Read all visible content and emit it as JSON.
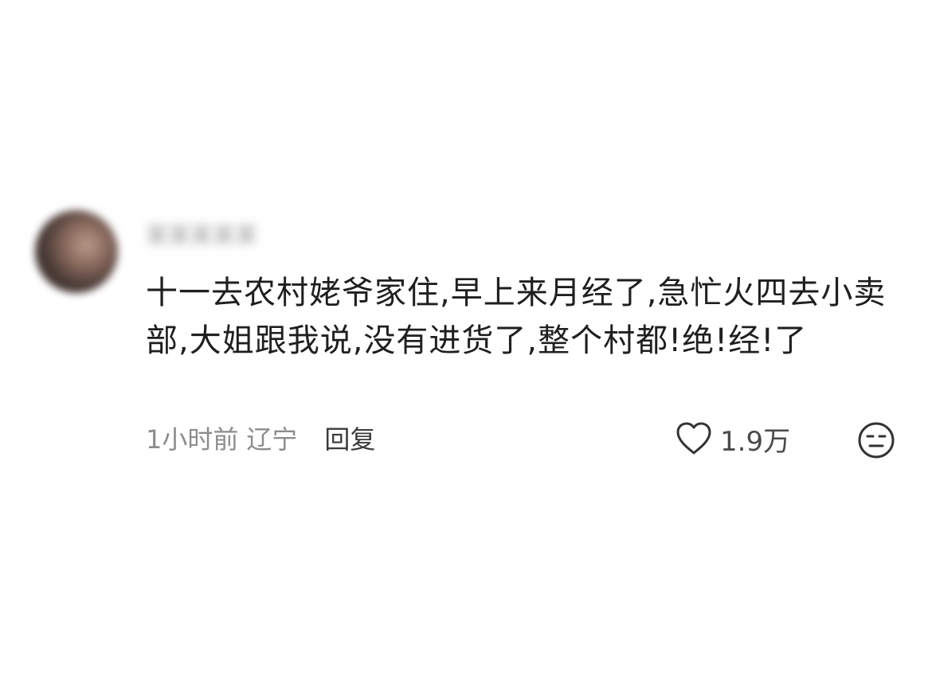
{
  "comment": {
    "username": "某某某某某",
    "content": "十一去农村姥爷家住,早上来月经了,急忙火四去小卖部,大姐跟我说,没有进货了,整个村都!绝!经!了",
    "time": "1小时前",
    "location": "辽宁",
    "reply_label": "回复",
    "like_count": "1.9万"
  },
  "icons": {
    "like": "heart-outline-icon",
    "reaction": "neutral-face-icon"
  },
  "colors": {
    "text": "#1f1f1f",
    "meta": "#8c8c8c",
    "icon": "#333333"
  }
}
